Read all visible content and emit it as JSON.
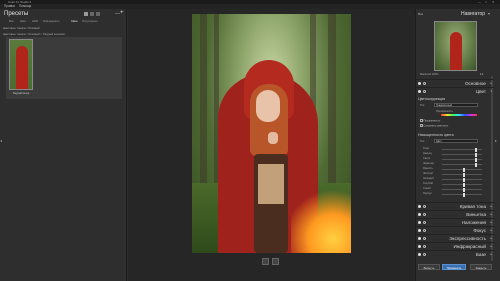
{
  "window": {
    "title": "Color Fx Studio 2",
    "controls": [
      "—",
      "□",
      "✕"
    ]
  },
  "menu": {
    "items": [
      "Правка",
      "Помощь"
    ]
  },
  "presets": {
    "title": "Пресеты",
    "tabs": [
      "Все",
      "Цвет",
      "HDR",
      "Инфракрасн.",
      "Свои",
      "Популярное"
    ],
    "active_tab": "Свои",
    "breadcrumbs": [
      "Цветовые тоника > Розовый",
      "Цветовые тоника > Розовый > Хмурый контраст"
    ],
    "thumb_label": "Хмурый вечер",
    "add": "+"
  },
  "navigator": {
    "all_label": "Все",
    "title": "Навигатор",
    "zoom": "Масштаб 100%",
    "zoom_value": "1:1"
  },
  "sections": {
    "basic": "Основное",
    "color": "Цвет",
    "colorfy": "Цветокоррекция",
    "color_type_label": "Тип",
    "color_type_value": "Градиентный",
    "colorfy_amount": "Прозрачность",
    "preserve_brightness": "Сохранить светлоты",
    "color_saturation": "Насыщенность цвета",
    "sat_type_label": "Тип",
    "sat_type_value": "Цвет",
    "tone": "Кривая тона",
    "vignette": "Виньетка",
    "overlay": "Наложения",
    "focus": "Фокус",
    "expressiveness": "Экспрессивность",
    "infrared": "Инфракрасный",
    "base": "Базе"
  },
  "sliders": [
    {
      "label": "Тона",
      "value": 0.85
    },
    {
      "label": "Насыщ.",
      "value": 0.85
    },
    {
      "label": "Свето",
      "value": 0.85
    },
    {
      "label": "Ждвечер",
      "value": 0.85
    },
    {
      "label": "Яркость",
      "value": 0.55
    },
    {
      "label": "Желтый",
      "value": 0.55
    },
    {
      "label": "Зеленый",
      "value": 0.55
    },
    {
      "label": "Голубой",
      "value": 0.55
    },
    {
      "label": "Синий",
      "value": 0.55
    },
    {
      "label": "Пурпур",
      "value": 0.55
    }
  ],
  "buttons": {
    "revert": "Вернуть",
    "apply": "Применить",
    "cancel": "Закрыть"
  }
}
